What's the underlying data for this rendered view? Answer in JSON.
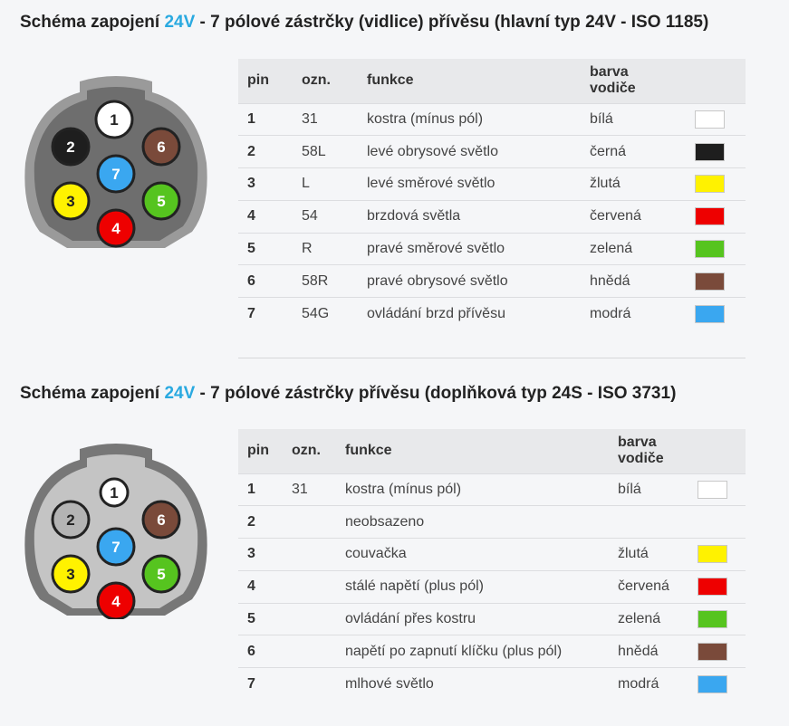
{
  "section1": {
    "title_pre": "Schéma zapojení ",
    "title_accent": "24V",
    "title_post": " - 7 pólové zástrčky (vidlice) přívěsu (hlavní typ 24V - ISO 1185)",
    "headers": {
      "pin": "pin",
      "ozn": "ozn.",
      "funkce": "funkce",
      "barva": "barva vodiče"
    },
    "rows": [
      {
        "pin": "1",
        "ozn": "31",
        "funkce": "kostra (mínus pól)",
        "barva": "bílá",
        "color": "#ffffff"
      },
      {
        "pin": "2",
        "ozn": "58L",
        "funkce": "levé obrysové světlo",
        "barva": "černá",
        "color": "#1e1e1e"
      },
      {
        "pin": "3",
        "ozn": "L",
        "funkce": "levé směrové světlo",
        "barva": "žlutá",
        "color": "#fff200"
      },
      {
        "pin": "4",
        "ozn": "54",
        "funkce": "brzdová světla",
        "barva": "červená",
        "color": "#ee0000"
      },
      {
        "pin": "5",
        "ozn": "R",
        "funkce": "pravé směrové světlo",
        "barva": "zelená",
        "color": "#56c41f"
      },
      {
        "pin": "6",
        "ozn": "58R",
        "funkce": "pravé obrysové světlo",
        "barva": "hnědá",
        "color": "#7a4a3a"
      },
      {
        "pin": "7",
        "ozn": "54G",
        "funkce": "ovládání brzd přívěsu",
        "barva": "modrá",
        "color": "#3aa7f0"
      }
    ],
    "connector_pins": [
      {
        "label": "1",
        "fill": "#ffffff",
        "text": "#222222"
      },
      {
        "label": "2",
        "fill": "#1e1e1e",
        "text": "#ffffff"
      },
      {
        "label": "3",
        "fill": "#fff200",
        "text": "#222222"
      },
      {
        "label": "4",
        "fill": "#ee0000",
        "text": "#ffffff"
      },
      {
        "label": "5",
        "fill": "#56c41f",
        "text": "#ffffff"
      },
      {
        "label": "6",
        "fill": "#7a4a3a",
        "text": "#ffffff"
      },
      {
        "label": "7",
        "fill": "#3aa7f0",
        "text": "#ffffff"
      }
    ]
  },
  "section2": {
    "title_pre": "Schéma zapojení ",
    "title_accent": "24V",
    "title_post": " - 7 pólové zástrčky přívěsu (doplňková typ 24S - ISO 3731)",
    "headers": {
      "pin": "pin",
      "ozn": "ozn.",
      "funkce": "funkce",
      "barva": "barva vodiče"
    },
    "rows": [
      {
        "pin": "1",
        "ozn": "31",
        "funkce": "kostra (mínus pól)",
        "barva": "bílá",
        "color": "#ffffff"
      },
      {
        "pin": "2",
        "ozn": "",
        "funkce": "neobsazeno",
        "barva": "",
        "color": ""
      },
      {
        "pin": "3",
        "ozn": "",
        "funkce": "couvačka",
        "barva": "žlutá",
        "color": "#fff200"
      },
      {
        "pin": "4",
        "ozn": "",
        "funkce": "stálé napětí (plus pól)",
        "barva": "červená",
        "color": "#ee0000"
      },
      {
        "pin": "5",
        "ozn": "",
        "funkce": "ovládání přes kostru",
        "barva": "zelená",
        "color": "#56c41f"
      },
      {
        "pin": "6",
        "ozn": "",
        "funkce": "napětí po zapnutí klíčku (plus pól)",
        "barva": "hnědá",
        "color": "#7a4a3a"
      },
      {
        "pin": "7",
        "ozn": "",
        "funkce": "mlhové světlo",
        "barva": "modrá",
        "color": "#3aa7f0"
      }
    ],
    "connector_pins": [
      {
        "label": "1",
        "fill": "#ffffff",
        "text": "#222222"
      },
      {
        "label": "2",
        "fill": "#b4b4b4",
        "text": "#222222"
      },
      {
        "label": "3",
        "fill": "#fff200",
        "text": "#222222"
      },
      {
        "label": "4",
        "fill": "#ee0000",
        "text": "#ffffff"
      },
      {
        "label": "5",
        "fill": "#56c41f",
        "text": "#ffffff"
      },
      {
        "label": "6",
        "fill": "#7a4a3a",
        "text": "#ffffff"
      },
      {
        "label": "7",
        "fill": "#3aa7f0",
        "text": "#ffffff"
      }
    ]
  }
}
